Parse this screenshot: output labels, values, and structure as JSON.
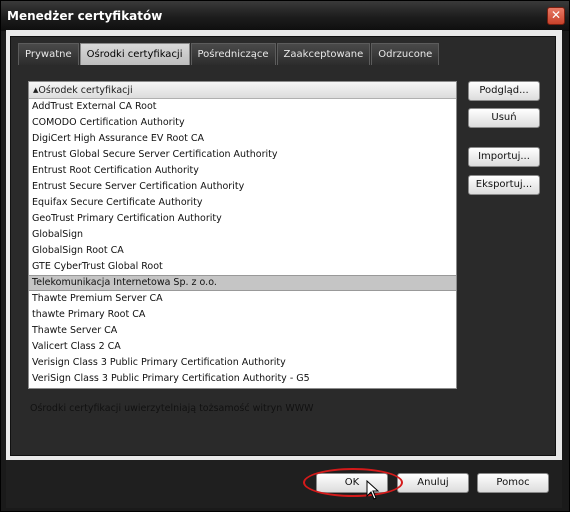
{
  "window": {
    "title": "Menedżer certyfikatów"
  },
  "tabs": [
    {
      "label": "Prywatne",
      "active": false
    },
    {
      "label": "Ośrodki certyfikacji",
      "active": true
    },
    {
      "label": "Pośredniczące",
      "active": false
    },
    {
      "label": "Zaakceptowane",
      "active": false
    },
    {
      "label": "Odrzucone",
      "active": false
    }
  ],
  "list": {
    "header": "Ośrodek certyfikacji",
    "items": [
      "AddTrust External CA Root",
      "COMODO Certification Authority",
      "DigiCert High Assurance EV Root CA",
      "Entrust Global Secure Server Certification Authority",
      "Entrust Root Certification Authority",
      "Entrust Secure Server Certification Authority",
      "Equifax Secure Certificate Authority",
      "GeoTrust Primary Certification Authority",
      "GlobalSign",
      "GlobalSign Root CA",
      "GTE CyberTrust Global Root",
      "Telekomunikacja Internetowa Sp. z o.o.",
      "Thawte Premium Server CA",
      "thawte Primary Root CA",
      "Thawte Server CA",
      "Valicert Class 2 CA",
      "Verisign Class 3 Public Primary Certification Authority",
      "VeriSign Class 3 Public Primary Certification Authority - G5"
    ],
    "selected_index": 11
  },
  "side_buttons": {
    "preview": "Podgląd...",
    "delete": "Usuń",
    "import": "Importuj...",
    "export": "Eksportuj..."
  },
  "description": "Ośrodki certyfikacji uwierzytelniają tożsamość witryn WWW",
  "bottom_buttons": {
    "ok": "OK",
    "cancel": "Anuluj",
    "help": "Pomoc"
  },
  "icons": {
    "close": "close-icon",
    "cursor": "mouse-pointer-icon"
  },
  "colors": {
    "highlight": "#d41a1a",
    "selected_row": "#c5c5c5"
  }
}
